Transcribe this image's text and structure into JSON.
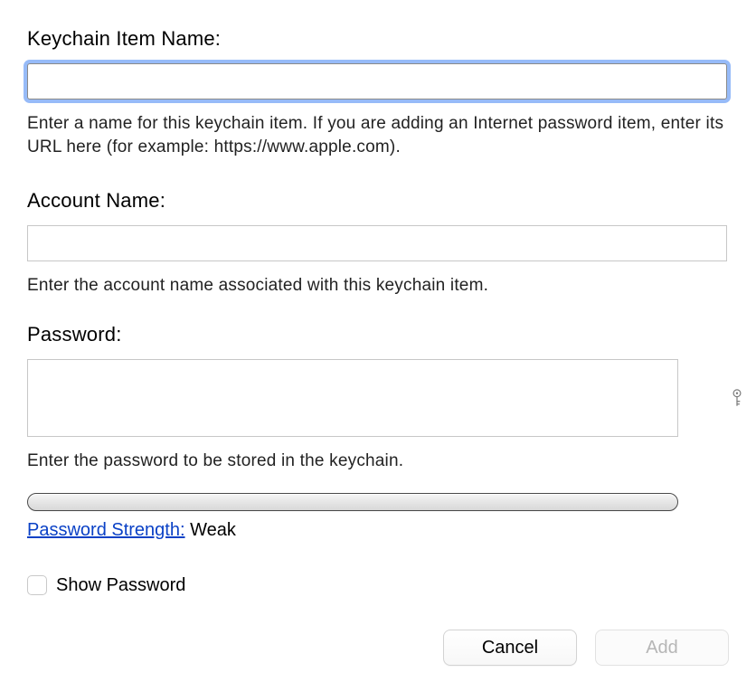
{
  "item_name": {
    "label": "Keychain Item Name:",
    "value": "",
    "help": "Enter a name for this keychain item. If you are adding an Internet password item, enter its URL here (for example: https://www.apple.com)."
  },
  "account_name": {
    "label": "Account Name:",
    "value": "",
    "help": "Enter the account name associated with this keychain item."
  },
  "password": {
    "label": "Password:",
    "value": "",
    "help": "Enter the password to be stored in the keychain.",
    "strength_label": "Password Strength:",
    "strength_value": "Weak",
    "show_password_label": "Show Password"
  },
  "buttons": {
    "cancel": "Cancel",
    "add": "Add"
  },
  "icons": {
    "key": "key-icon"
  }
}
